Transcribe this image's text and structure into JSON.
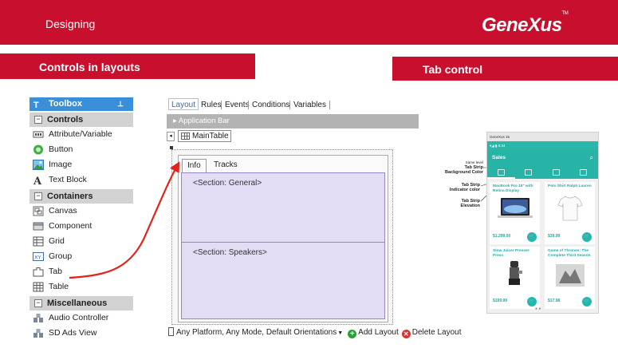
{
  "header": {
    "title": "Designing",
    "logo": "GeneXus",
    "logo_tm": "TM"
  },
  "sections": {
    "left": "Controls in layouts",
    "right": "Tab control"
  },
  "toolbox": {
    "title": "Toolbox",
    "groups": [
      {
        "label": "Controls",
        "items": [
          "Attribute/Variable",
          "Button",
          "Image",
          "Text Block"
        ]
      },
      {
        "label": "Containers",
        "items": [
          "Canvas",
          "Component",
          "Grid",
          "Group",
          "Tab",
          "Table"
        ]
      },
      {
        "label": "Miscellaneous",
        "items": [
          "Audio Controller",
          "SD Ads View"
        ]
      }
    ]
  },
  "designer": {
    "tabs": [
      "Layout",
      "Rules",
      "Events",
      "Conditions",
      "Variables"
    ],
    "app_bar": "Application Bar",
    "nav_left": "◂",
    "main_table": "MainTable",
    "tab_control": {
      "tabs": [
        "Info",
        "Tracks"
      ],
      "sections": [
        "<Section: General>",
        "<Section: Speakers>"
      ]
    },
    "footer": {
      "platform": "Any Platform, Any Mode, Default Orientations",
      "add": "Add Layout",
      "delete": "Delete Layout"
    }
  },
  "phone": {
    "status_left": "GeneXus 15",
    "status_right": "▾◢ ▮ 6:34",
    "app_title": "Sales",
    "search_icon": "⌕",
    "accent": "#27b3a6",
    "products": [
      {
        "name": "MacBook Pro 15\" with Retina Display",
        "price": "$1,299.00"
      },
      {
        "name": "Polo Shirt Ralph Lauren",
        "price": "$39.99"
      },
      {
        "name": "Slow Juicer Presser Press",
        "price": "$199.99"
      },
      {
        "name": "Game of Thrones: The Complete Third Season",
        "price": "$17.98"
      }
    ],
    "annotations": {
      "same_level": "Same level",
      "bg_color": "Tab Strip Background Color",
      "indicator": "Tab Strip Indicator color",
      "elevation": "Tab Strip Elevation"
    }
  },
  "colors": {
    "brand_red": "#c8102e",
    "toolbox_blue": "#3b8fd8",
    "tab_body": "#e3dcf5"
  }
}
